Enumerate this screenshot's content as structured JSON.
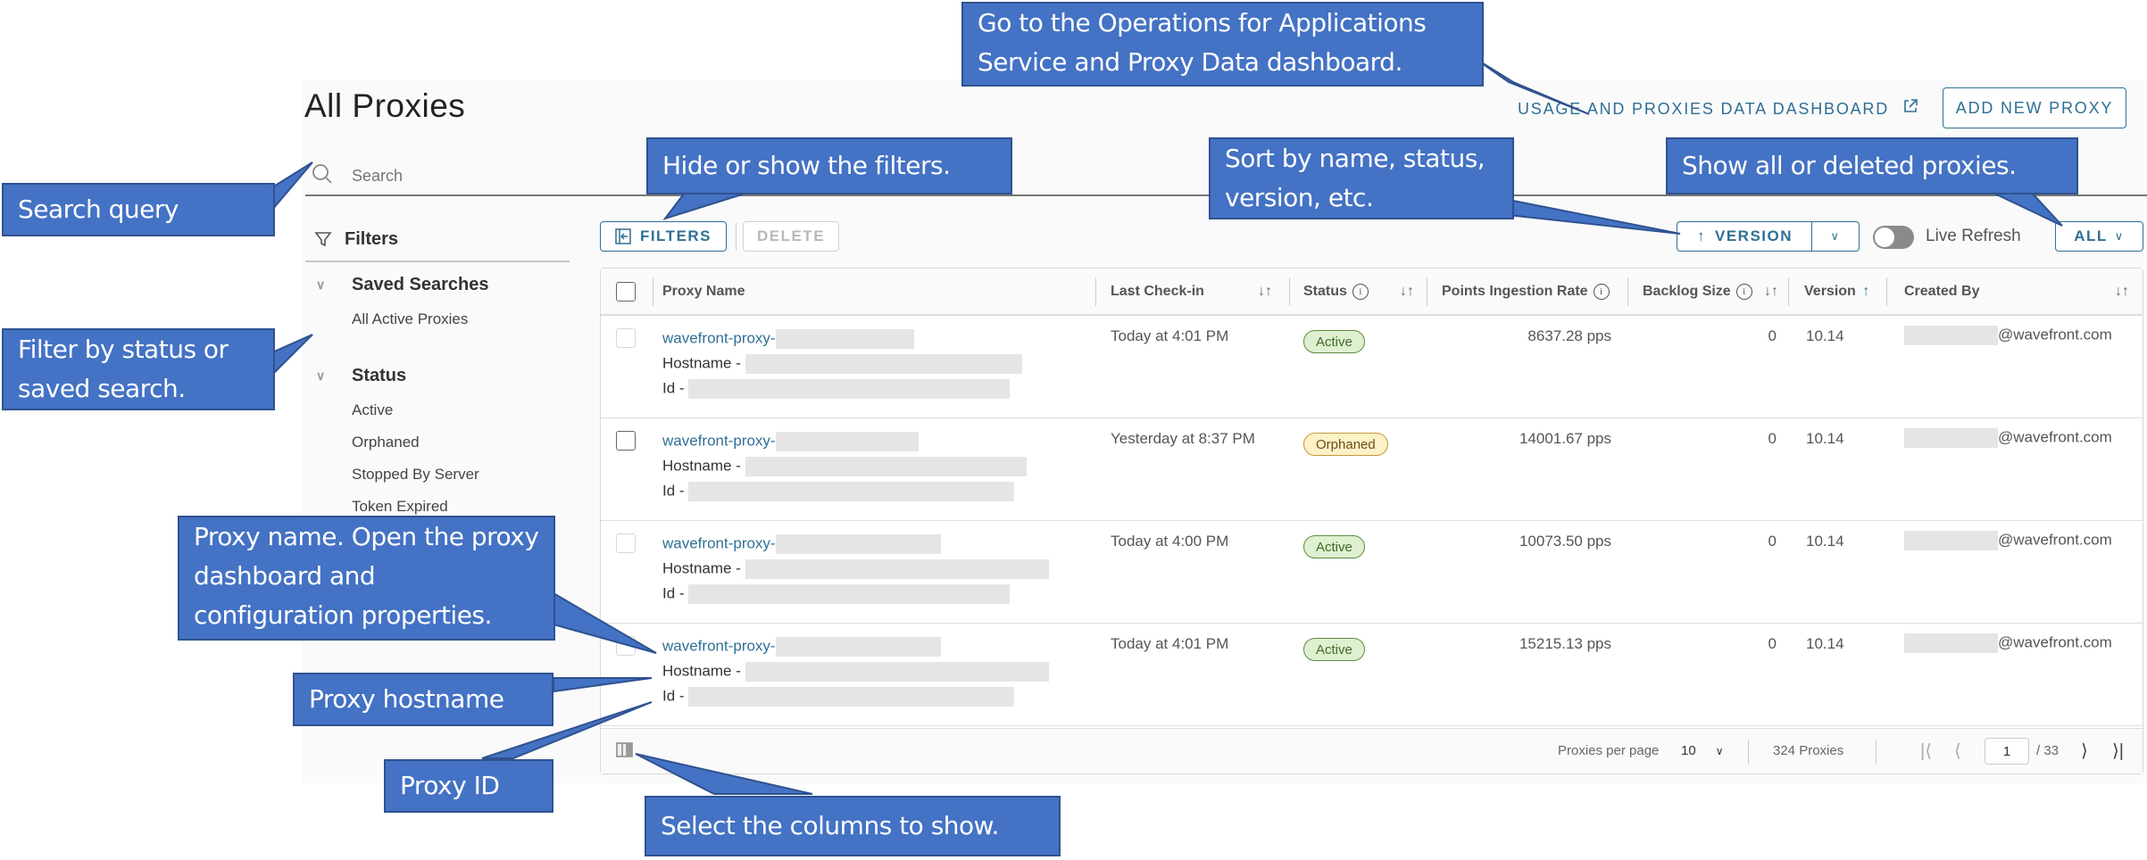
{
  "page": {
    "title": "All Proxies",
    "dashboard_link": "USAGE AND PROXIES DATA DASHBOARD",
    "add_button": "ADD NEW PROXY",
    "search_placeholder": "Search"
  },
  "sidebar": {
    "filters_label": "Filters",
    "sections": [
      {
        "label": "Saved Searches",
        "items": [
          "All Active Proxies"
        ]
      },
      {
        "label": "Status",
        "items": [
          "Active",
          "Orphaned",
          "Stopped By Server",
          "Token Expired"
        ]
      }
    ]
  },
  "toolbar": {
    "filters_button": "FILTERS",
    "delete_button": "DELETE",
    "sort_button": "VERSION",
    "live_refresh_label": "Live Refresh",
    "live_refresh_on": false,
    "scope_select": "ALL"
  },
  "table": {
    "columns": [
      "Proxy Name",
      "Last Check-in",
      "Status",
      "Points Ingestion Rate",
      "Backlog Size",
      "Version",
      "Created By"
    ],
    "rows": [
      {
        "name_prefix": "wavefront-proxy-",
        "hostname_label": "Hostname -",
        "id_label": "Id -",
        "last_checkin": "Today at 4:01 PM",
        "status": "Active",
        "ingestion_rate": "8637.28 pps",
        "backlog": "0",
        "version": "10.14",
        "created_by_domain": "@wavefront.com"
      },
      {
        "name_prefix": "wavefront-proxy-",
        "hostname_label": "Hostname -",
        "id_label": "Id -",
        "last_checkin": "Yesterday at 8:37 PM",
        "status": "Orphaned",
        "ingestion_rate": "14001.67 pps",
        "backlog": "0",
        "version": "10.14",
        "created_by_domain": "@wavefront.com"
      },
      {
        "name_prefix": "wavefront-proxy-",
        "hostname_label": "Hostname -",
        "id_label": "Id -",
        "last_checkin": "Today at 4:00 PM",
        "status": "Active",
        "ingestion_rate": "10073.50 pps",
        "backlog": "0",
        "version": "10.14",
        "created_by_domain": "@wavefront.com"
      },
      {
        "name_prefix": "wavefront-proxy-",
        "hostname_label": "Hostname -",
        "id_label": "Id -",
        "last_checkin": "Today at 4:01 PM",
        "status": "Active",
        "ingestion_rate": "15215.13 pps",
        "backlog": "0",
        "version": "10.14",
        "created_by_domain": "@wavefront.com"
      }
    ]
  },
  "footer": {
    "per_page_label": "Proxies per page",
    "per_page_value": "10",
    "total": "324 Proxies",
    "current_page": "1",
    "total_pages": "/ 33"
  },
  "callouts": {
    "dashboard": "Go to the Operations for Applications Service and Proxy Data dashboard.",
    "search": "Search query",
    "filters_toggle": "Hide or show the filters.",
    "sort": "Sort by name, status, version, etc.",
    "scope": "Show all or deleted proxies.",
    "filter_by": "Filter by status or saved search.",
    "proxy_name": "Proxy name. Open the proxy dashboard and configuration properties.",
    "hostname": "Proxy hostname",
    "proxy_id": "Proxy ID",
    "columns": "Select the columns to show."
  },
  "colors": {
    "accent": "#2f6f94",
    "callout_fill": "#4472c4",
    "active_badge": "#dff0d0",
    "orphaned_badge": "#fdf1c8"
  }
}
